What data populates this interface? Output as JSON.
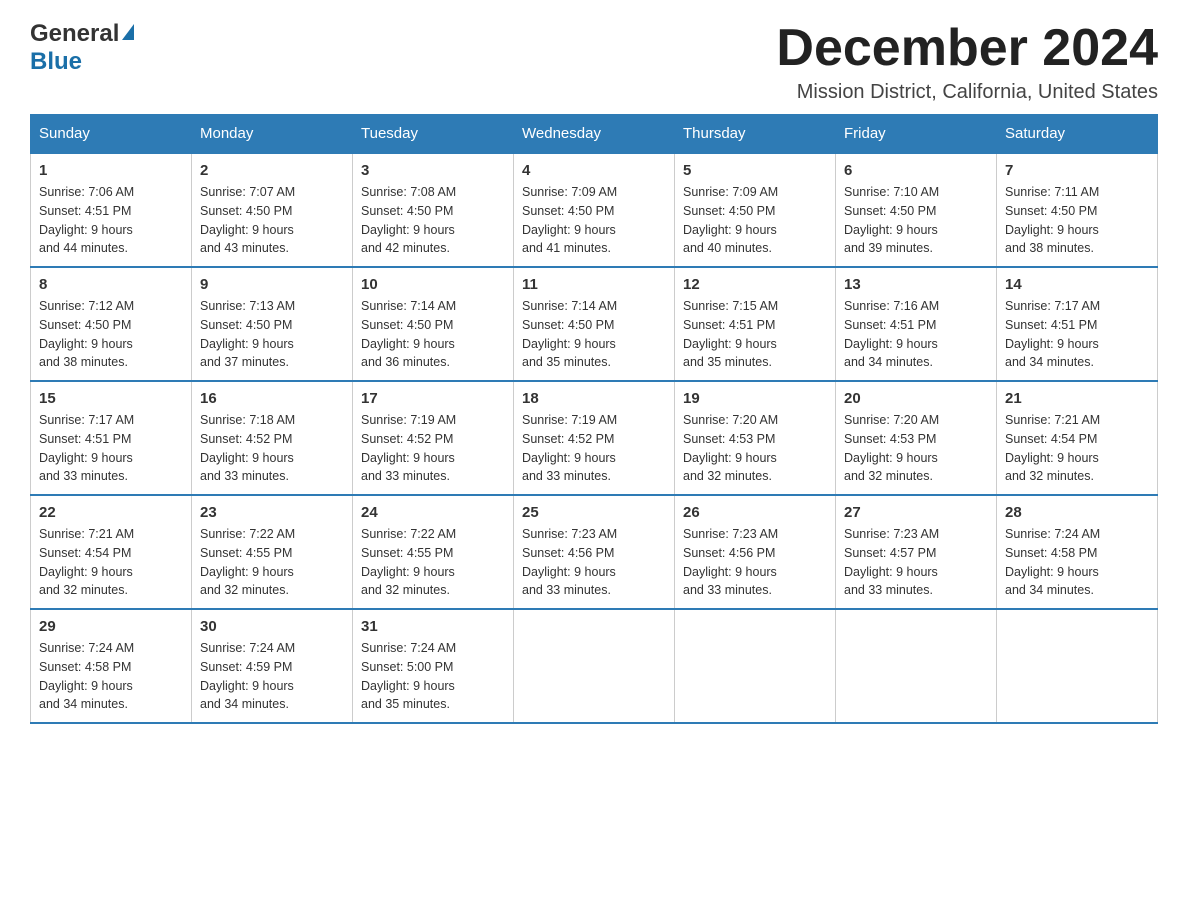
{
  "logo": {
    "general": "General",
    "blue": "Blue"
  },
  "header": {
    "month_year": "December 2024",
    "location": "Mission District, California, United States"
  },
  "days_of_week": [
    "Sunday",
    "Monday",
    "Tuesday",
    "Wednesday",
    "Thursday",
    "Friday",
    "Saturday"
  ],
  "weeks": [
    [
      {
        "day": "1",
        "sunrise": "7:06 AM",
        "sunset": "4:51 PM",
        "daylight": "9 hours and 44 minutes."
      },
      {
        "day": "2",
        "sunrise": "7:07 AM",
        "sunset": "4:50 PM",
        "daylight": "9 hours and 43 minutes."
      },
      {
        "day": "3",
        "sunrise": "7:08 AM",
        "sunset": "4:50 PM",
        "daylight": "9 hours and 42 minutes."
      },
      {
        "day": "4",
        "sunrise": "7:09 AM",
        "sunset": "4:50 PM",
        "daylight": "9 hours and 41 minutes."
      },
      {
        "day": "5",
        "sunrise": "7:09 AM",
        "sunset": "4:50 PM",
        "daylight": "9 hours and 40 minutes."
      },
      {
        "day": "6",
        "sunrise": "7:10 AM",
        "sunset": "4:50 PM",
        "daylight": "9 hours and 39 minutes."
      },
      {
        "day": "7",
        "sunrise": "7:11 AM",
        "sunset": "4:50 PM",
        "daylight": "9 hours and 38 minutes."
      }
    ],
    [
      {
        "day": "8",
        "sunrise": "7:12 AM",
        "sunset": "4:50 PM",
        "daylight": "9 hours and 38 minutes."
      },
      {
        "day": "9",
        "sunrise": "7:13 AM",
        "sunset": "4:50 PM",
        "daylight": "9 hours and 37 minutes."
      },
      {
        "day": "10",
        "sunrise": "7:14 AM",
        "sunset": "4:50 PM",
        "daylight": "9 hours and 36 minutes."
      },
      {
        "day": "11",
        "sunrise": "7:14 AM",
        "sunset": "4:50 PM",
        "daylight": "9 hours and 35 minutes."
      },
      {
        "day": "12",
        "sunrise": "7:15 AM",
        "sunset": "4:51 PM",
        "daylight": "9 hours and 35 minutes."
      },
      {
        "day": "13",
        "sunrise": "7:16 AM",
        "sunset": "4:51 PM",
        "daylight": "9 hours and 34 minutes."
      },
      {
        "day": "14",
        "sunrise": "7:17 AM",
        "sunset": "4:51 PM",
        "daylight": "9 hours and 34 minutes."
      }
    ],
    [
      {
        "day": "15",
        "sunrise": "7:17 AM",
        "sunset": "4:51 PM",
        "daylight": "9 hours and 33 minutes."
      },
      {
        "day": "16",
        "sunrise": "7:18 AM",
        "sunset": "4:52 PM",
        "daylight": "9 hours and 33 minutes."
      },
      {
        "day": "17",
        "sunrise": "7:19 AM",
        "sunset": "4:52 PM",
        "daylight": "9 hours and 33 minutes."
      },
      {
        "day": "18",
        "sunrise": "7:19 AM",
        "sunset": "4:52 PM",
        "daylight": "9 hours and 33 minutes."
      },
      {
        "day": "19",
        "sunrise": "7:20 AM",
        "sunset": "4:53 PM",
        "daylight": "9 hours and 32 minutes."
      },
      {
        "day": "20",
        "sunrise": "7:20 AM",
        "sunset": "4:53 PM",
        "daylight": "9 hours and 32 minutes."
      },
      {
        "day": "21",
        "sunrise": "7:21 AM",
        "sunset": "4:54 PM",
        "daylight": "9 hours and 32 minutes."
      }
    ],
    [
      {
        "day": "22",
        "sunrise": "7:21 AM",
        "sunset": "4:54 PM",
        "daylight": "9 hours and 32 minutes."
      },
      {
        "day": "23",
        "sunrise": "7:22 AM",
        "sunset": "4:55 PM",
        "daylight": "9 hours and 32 minutes."
      },
      {
        "day": "24",
        "sunrise": "7:22 AM",
        "sunset": "4:55 PM",
        "daylight": "9 hours and 32 minutes."
      },
      {
        "day": "25",
        "sunrise": "7:23 AM",
        "sunset": "4:56 PM",
        "daylight": "9 hours and 33 minutes."
      },
      {
        "day": "26",
        "sunrise": "7:23 AM",
        "sunset": "4:56 PM",
        "daylight": "9 hours and 33 minutes."
      },
      {
        "day": "27",
        "sunrise": "7:23 AM",
        "sunset": "4:57 PM",
        "daylight": "9 hours and 33 minutes."
      },
      {
        "day": "28",
        "sunrise": "7:24 AM",
        "sunset": "4:58 PM",
        "daylight": "9 hours and 34 minutes."
      }
    ],
    [
      {
        "day": "29",
        "sunrise": "7:24 AM",
        "sunset": "4:58 PM",
        "daylight": "9 hours and 34 minutes."
      },
      {
        "day": "30",
        "sunrise": "7:24 AM",
        "sunset": "4:59 PM",
        "daylight": "9 hours and 34 minutes."
      },
      {
        "day": "31",
        "sunrise": "7:24 AM",
        "sunset": "5:00 PM",
        "daylight": "9 hours and 35 minutes."
      },
      null,
      null,
      null,
      null
    ]
  ],
  "labels": {
    "sunrise": "Sunrise:",
    "sunset": "Sunset:",
    "daylight": "Daylight:"
  }
}
